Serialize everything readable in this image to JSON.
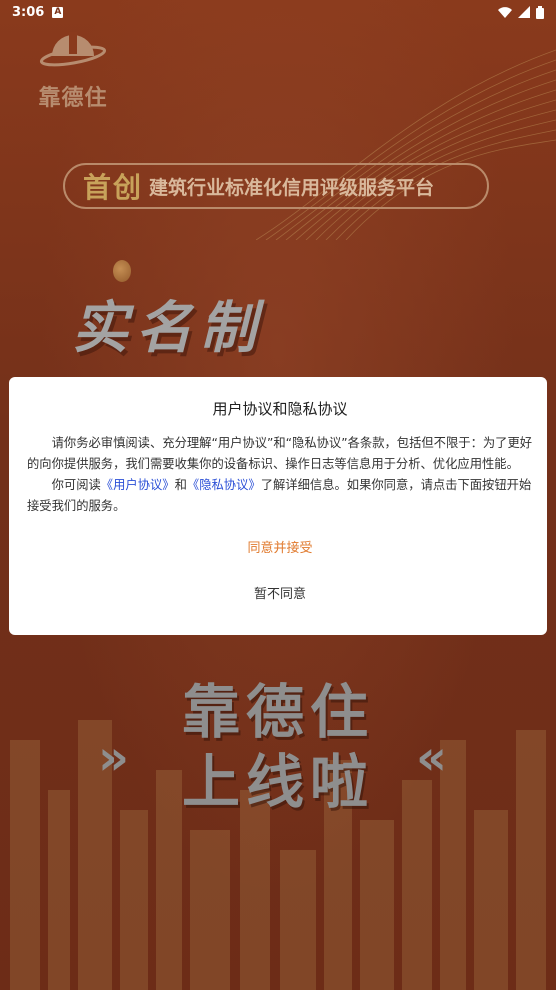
{
  "status": {
    "time": "3:06",
    "notif_icon_letter": "A"
  },
  "logo": {
    "word": "靠德住"
  },
  "banner": {
    "highlight": "首创",
    "text": "建筑行业标准化信用评级服务平台"
  },
  "hero": {
    "realname": "实名制",
    "line1": "靠德住",
    "line2": "上线啦",
    "left_chev": "»",
    "right_chev": "«"
  },
  "dialog": {
    "title": "用户协议和隐私协议",
    "p1": "请你务必审慎阅读、充分理解“用户协议”和“隐私协议”各条款，包括但不限于：为了更好的向你提供服务，我们需要收集你的设备标识、操作日志等信息用于分析、优化应用性能。",
    "p2_prefix": "你可阅读",
    "p2_link1": "《用户协议》",
    "p2_and": "和",
    "p2_link2": "《隐私协议》",
    "p2_suffix": "了解详细信息。如果你同意，请点击下面按钮开始接受我们的服务。",
    "agree_label": "同意并接受",
    "disagree_label": "暂不同意"
  },
  "colors": {
    "background": "#7a3118",
    "accent": "#e07a2e",
    "link": "#2b4fd6"
  }
}
